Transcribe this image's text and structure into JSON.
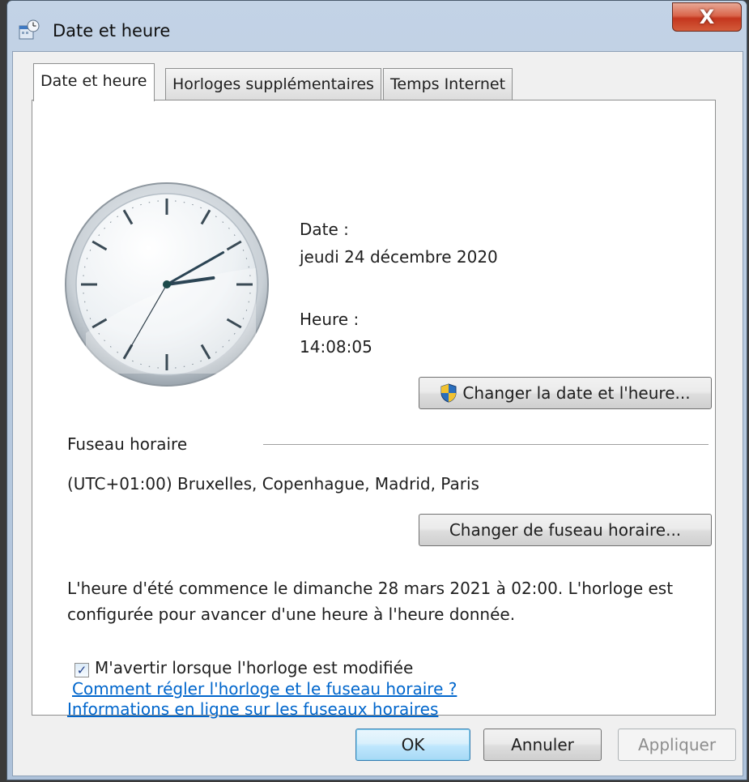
{
  "window": {
    "title": "Date et heure",
    "close_label": "X"
  },
  "tabs": [
    {
      "label": "Date et heure",
      "active": true
    },
    {
      "label": "Horloges supplémentaires",
      "active": false
    },
    {
      "label": "Temps Internet",
      "active": false
    }
  ],
  "clock": {
    "hour": 14,
    "minute": 8,
    "second": 5
  },
  "datetime": {
    "date_label": "Date :",
    "date_value": "jeudi 24 décembre 2020",
    "time_label": "Heure :",
    "time_value": "14:08:05",
    "change_button": "Changer la date et l'heure..."
  },
  "timezone": {
    "section_label": "Fuseau horaire",
    "value": "(UTC+01:00) Bruxelles, Copenhague, Madrid, Paris",
    "change_button": "Changer de fuseau horaire..."
  },
  "dst": {
    "line1": "L'heure d'été commence le dimanche 28 mars 2021 à 02:00. L'horloge est",
    "line2": "configurée pour avancer d'une heure à l'heure donnée."
  },
  "notify": {
    "label": "M'avertir lorsque l'horloge est modifiée",
    "checked": true
  },
  "links": {
    "info": "Informations en ligne sur les fuseaux horaires",
    "howto": "Comment régler l'horloge et le fuseau horaire ?"
  },
  "footer": {
    "ok": "OK",
    "cancel": "Annuler",
    "apply": "Appliquer"
  },
  "colors": {
    "link": "#0066cc",
    "shield_blue": "#2a6ebd",
    "shield_yellow": "#f2c230"
  }
}
